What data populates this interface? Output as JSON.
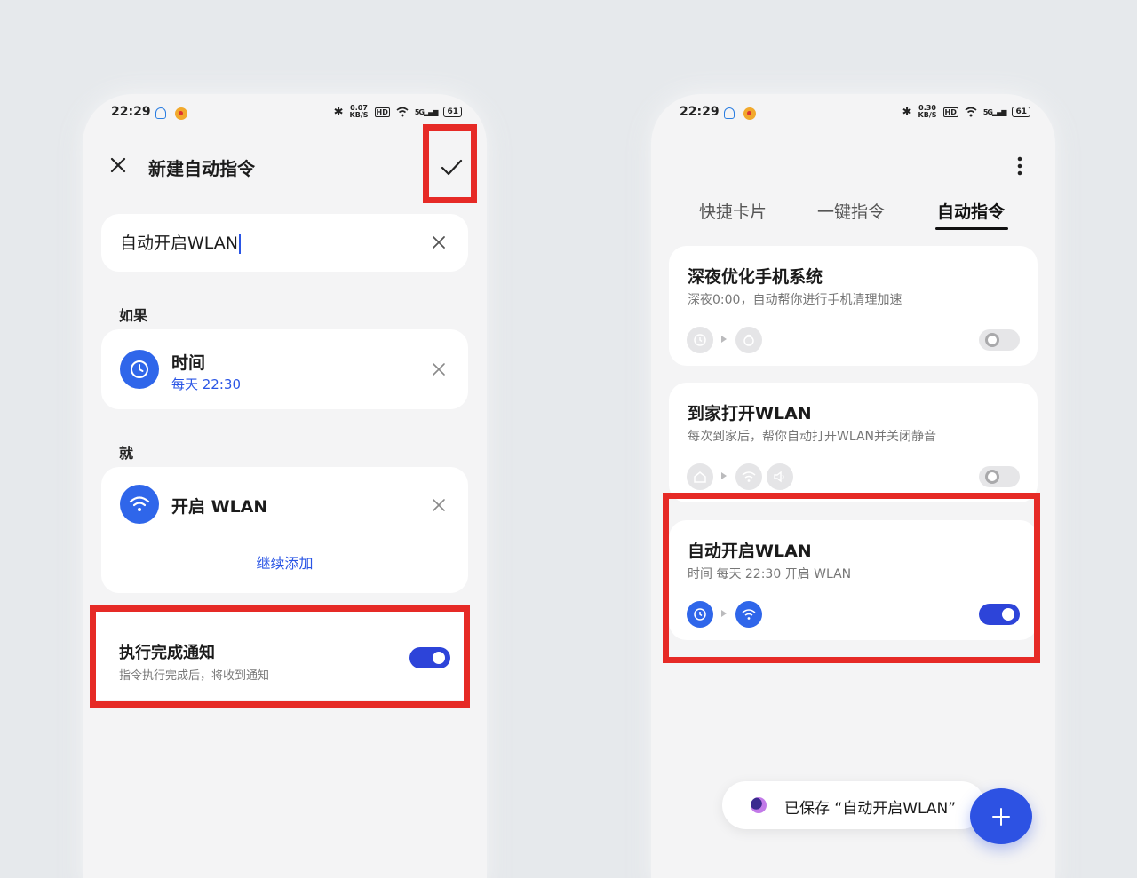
{
  "left": {
    "status": {
      "time": "22:29",
      "speed_top": "0.07",
      "speed_bottom": "KB/S",
      "hd": "HD",
      "network": "5G",
      "battery": "61"
    },
    "header": {
      "title": "新建自动指令"
    },
    "name_field": {
      "value": "自动开启WLAN"
    },
    "if_label": "如果",
    "condition": {
      "title": "时间",
      "subtitle": "每天 22:30"
    },
    "then_label": "就",
    "action": {
      "title": "开启 WLAN",
      "add_more": "继续添加"
    },
    "notify": {
      "title": "执行完成通知",
      "subtitle": "指令执行完成后，将收到通知",
      "enabled": true
    }
  },
  "right": {
    "status": {
      "time": "22:29",
      "speed_top": "0.30",
      "speed_bottom": "KB/S",
      "hd": "HD",
      "network": "5G",
      "battery": "61"
    },
    "tabs": [
      {
        "label": "快捷卡片"
      },
      {
        "label": "一键指令"
      },
      {
        "label": "自动指令",
        "active": true
      }
    ],
    "commands": [
      {
        "title": "深夜优化手机系统",
        "subtitle": "深夜0:00，自动帮你进行手机清理加速",
        "enabled": false
      },
      {
        "title": "到家打开WLAN",
        "subtitle": "每次到家后，帮你自动打开WLAN并关闭静音",
        "enabled": false
      },
      {
        "title": "自动开启WLAN",
        "subtitle": "时间 每天 22:30 开启 WLAN",
        "enabled": true
      }
    ],
    "toast": {
      "text": "已保存 “自动开启WLAN”"
    }
  },
  "colors": {
    "accent": "#2d44d9",
    "highlight": "#e62a26",
    "background": "#e6e9ec"
  }
}
